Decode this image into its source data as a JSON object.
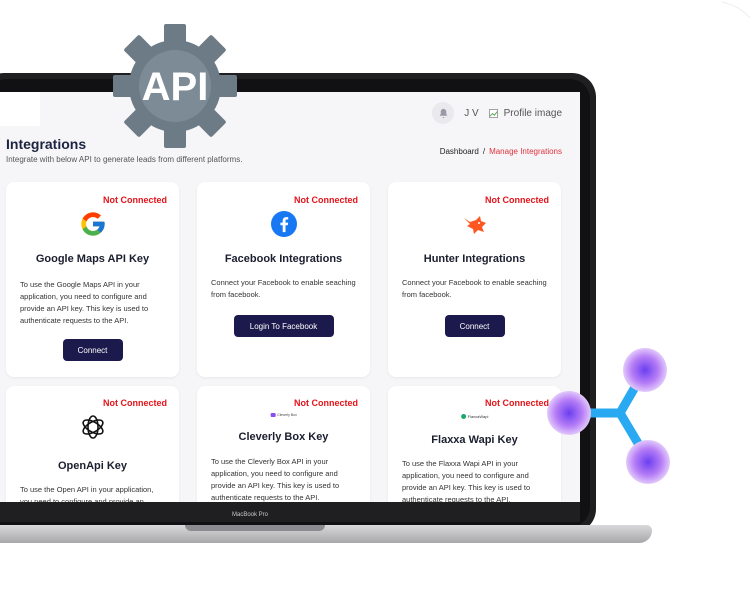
{
  "header": {
    "user_initials": "J V",
    "profile_alt": "Profile image"
  },
  "page": {
    "title": "Integrations",
    "subtitle": "Integrate with below API to generate leads from different platforms."
  },
  "breadcrumb": {
    "home": "Dashboard",
    "separator": "/",
    "current": "Manage Integrations"
  },
  "cards": [
    {
      "status": "Not Connected",
      "title": "Google Maps API Key",
      "description": "To use the Google Maps API in your application, you need to configure and provide an API key. This key is used to authenticate requests to the API.",
      "button": "Connect",
      "icon": "google-icon"
    },
    {
      "status": "Not Connected",
      "title": "Facebook Integrations",
      "description": "Connect your Facebook to enable seaching from facebook.",
      "button": "Login To Facebook",
      "icon": "facebook-icon"
    },
    {
      "status": "Not Connected",
      "title": "Hunter Integrations",
      "description": "Connect your Facebook to enable seaching from facebook.",
      "button": "Connect",
      "icon": "hunter-fox-icon"
    },
    {
      "status": "Not Connected",
      "title": "OpenApi Key",
      "description": "To use the Open API in your application, you need to configure and provide an",
      "icon": "openai-icon"
    },
    {
      "status": "Not Connected",
      "title": "Cleverly Box Key",
      "description": "To use the Cleverly Box API in your application, you need to configure and provide an API key. This key is used to authenticate requests to the API.",
      "icon": "cleverly-box-logo",
      "logo_text": "Cleverly Box"
    },
    {
      "status": "Not Connected",
      "title": "Flaxxa Wapi Key",
      "description": "To use the Flaxxa Wapi API in your application, you need to configure and provide an API key. This key is used to authenticate requests to the API.",
      "icon": "flaxxa-wapi-logo",
      "logo_text": "FlaxxaWapi"
    }
  ],
  "device": {
    "label": "MacBook Pro"
  },
  "decor": {
    "gear_text": "API",
    "gear_color": "#6d7b86",
    "molecule_color": "#29a9f1",
    "node_color": "#7b52e9"
  },
  "colors": {
    "status_red": "#e3141b",
    "button_navy": "#1c1a4c",
    "breadcrumb_active": "#e0323c"
  }
}
